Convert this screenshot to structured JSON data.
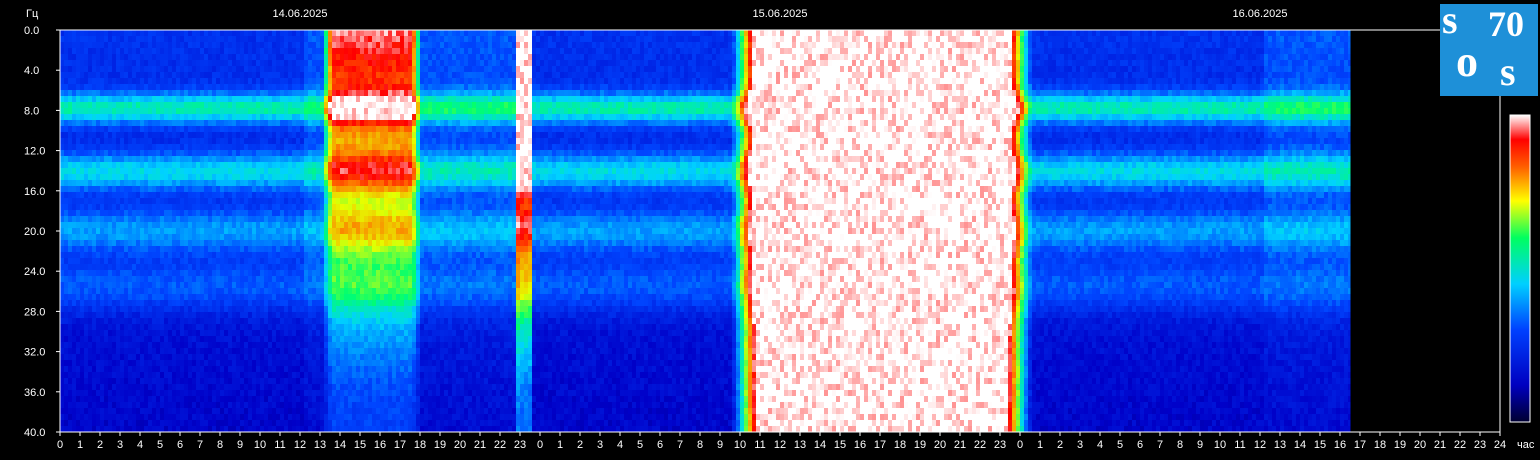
{
  "chart_data": {
    "type": "heatmap",
    "title": "",
    "ylabel": "Гц",
    "xlabel": "час",
    "ylim": [
      0,
      40
    ],
    "y_ticks": [
      "0.0",
      "4.0",
      "8.0",
      "12.0",
      "16.0",
      "20.0",
      "24.0",
      "28.0",
      "32.0",
      "36.0",
      "40.0"
    ],
    "x_ticks": [
      "0",
      "1",
      "2",
      "3",
      "4",
      "5",
      "6",
      "7",
      "8",
      "9",
      "10",
      "11",
      "12",
      "13",
      "14",
      "15",
      "16",
      "17",
      "18",
      "19",
      "20",
      "21",
      "22",
      "23",
      "0",
      "1",
      "2",
      "3",
      "4",
      "5",
      "6",
      "7",
      "8",
      "9",
      "10",
      "11",
      "12",
      "13",
      "14",
      "15",
      "16",
      "17",
      "18",
      "19",
      "20",
      "21",
      "22",
      "23",
      "0",
      "1",
      "2",
      "3",
      "4",
      "5",
      "6",
      "7",
      "8",
      "9",
      "10",
      "11",
      "12",
      "13",
      "14",
      "15",
      "16",
      "17",
      "18",
      "19",
      "20",
      "21",
      "22",
      "23",
      "24"
    ],
    "dates": [
      "14.06.2025",
      "15.06.2025",
      "16.06.2025"
    ],
    "data_end_hour": 64.5,
    "resonance_bands_hz": [
      7.8,
      14.1,
      20.0,
      25.5
    ],
    "bursts": [
      {
        "start_h": 13.5,
        "end_h": 17.5,
        "intensity": 0.6
      },
      {
        "start_h": 22.7,
        "end_h": 23.5,
        "intensity": 0.95
      },
      {
        "start_h": 35.0,
        "end_h": 47.0,
        "intensity": 1.0
      }
    ],
    "colorscale": [
      "#000080",
      "#0000ff",
      "#00c8ff",
      "#00ff80",
      "#ffff00",
      "#ff8000",
      "#ff0000",
      "#ffffff"
    ]
  },
  "logo": {
    "text": "sos70",
    "s1": "s",
    "o": "o",
    "s2": "s",
    "digits": "70",
    "background": "#1e90d8"
  }
}
